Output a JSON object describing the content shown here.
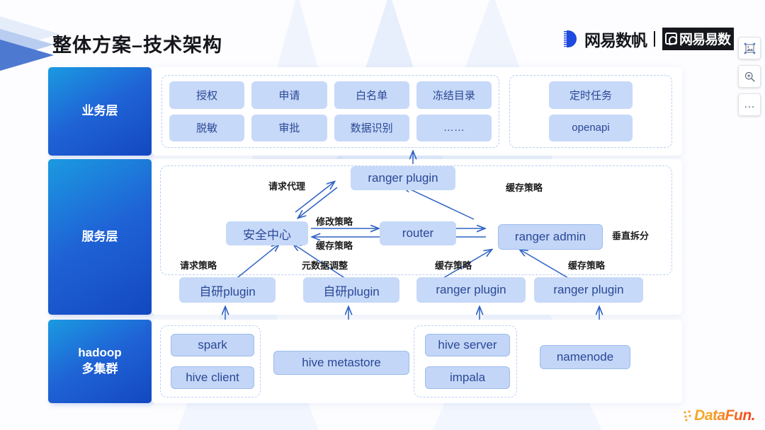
{
  "header": {
    "title": "整体方案–技术架构",
    "logo_primary": "网易数帆",
    "logo_secondary": "网易易数"
  },
  "tools": [
    {
      "name": "crop-image-icon",
      "label": ""
    },
    {
      "name": "zoom-in-icon",
      "label": ""
    },
    {
      "name": "more-options-icon",
      "label": "…"
    }
  ],
  "layers": {
    "business": {
      "tag": "业务层",
      "groups": [
        {
          "chips": [
            "授权",
            "申请",
            "白名单",
            "冻结目录",
            "脱敏",
            "审批",
            "数据识别",
            "……"
          ]
        },
        {
          "chips": [
            "定时任务",
            "openapi"
          ]
        }
      ]
    },
    "service": {
      "tag": "服务层",
      "nodes": [
        {
          "id": "ranger-plugin-top",
          "label": "ranger plugin"
        },
        {
          "id": "security-center",
          "label": "安全中心"
        },
        {
          "id": "router",
          "label": "router"
        },
        {
          "id": "ranger-admin",
          "label": "ranger admin"
        }
      ],
      "edge_labels": [
        "请求代理",
        "修改策略",
        "缓存策略",
        "缓存策略",
        "垂直拆分",
        "请求策略",
        "元数据调整",
        "缓存策略",
        "缓存策略"
      ],
      "plugins": [
        "自研plugin",
        "自研plugin",
        "ranger plugin",
        "ranger plugin"
      ]
    },
    "hadoop": {
      "tag": "hadoop\n多集群",
      "tag_line1": "hadoop",
      "tag_line2": "多集群",
      "nodes": [
        "spark",
        "hive client",
        "hive metastore",
        "hive server",
        "impala",
        "namenode"
      ]
    }
  },
  "watermark": "DataFun.",
  "colors": {
    "node_fill": "#c7d9f8",
    "node_text": "#2a4896",
    "layer_tag_start": "#1b9ae0",
    "layer_tag_end": "#1348c0",
    "arrow": "#2f63c4",
    "dashed_border": "#b9cdf2"
  }
}
